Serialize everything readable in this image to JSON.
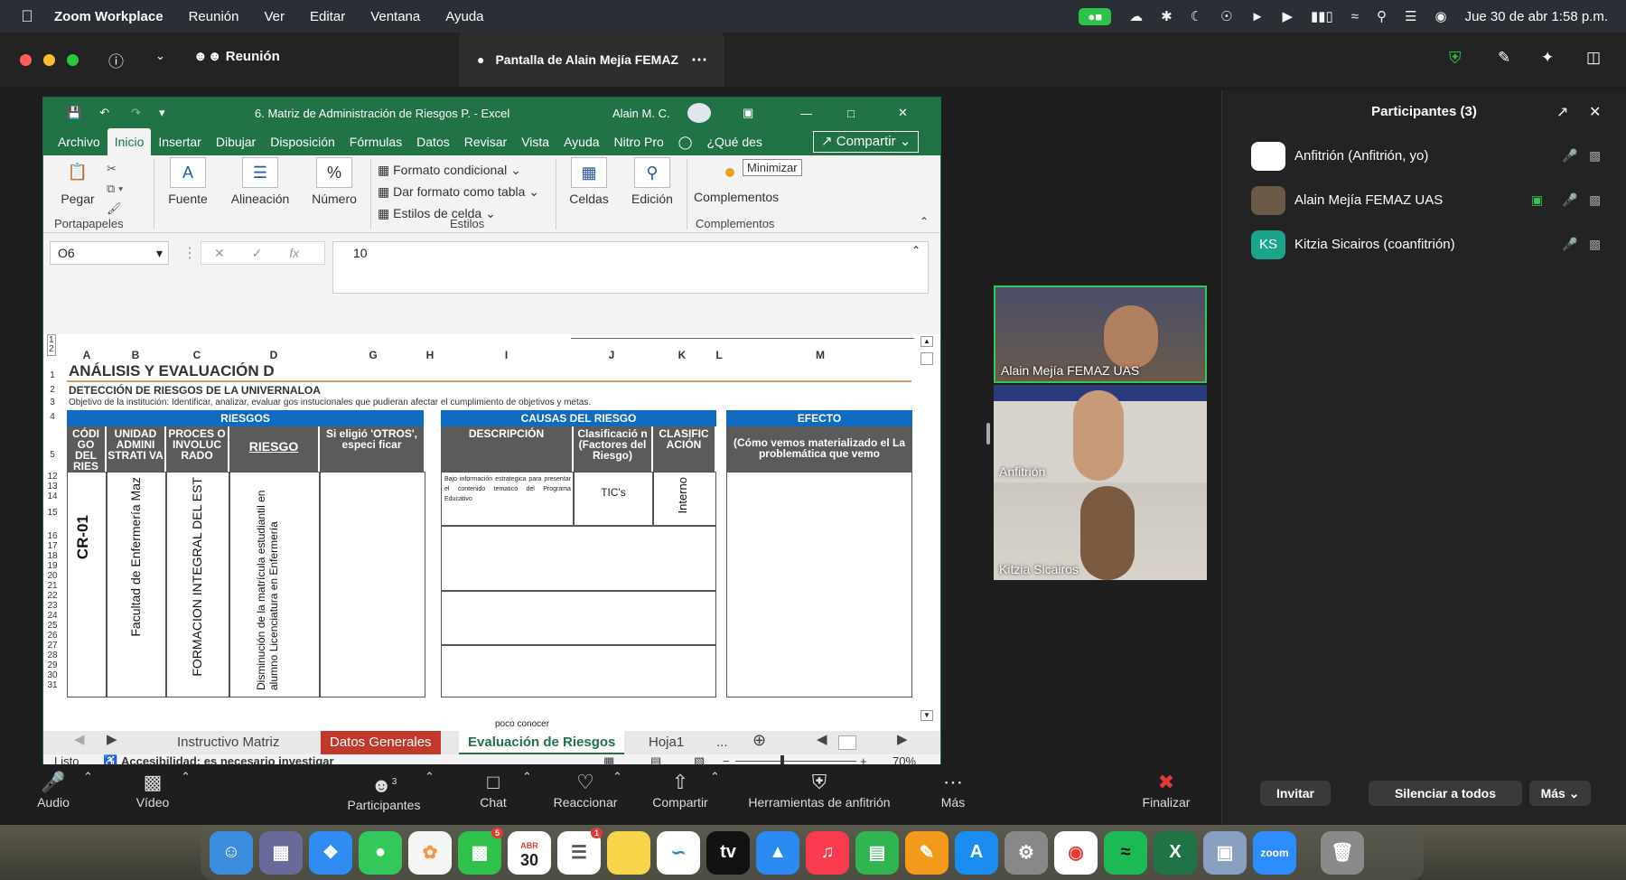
{
  "menubar": {
    "app_name": "Zoom Workplace",
    "items": [
      "Reunión",
      "Ver",
      "Editar",
      "Ventana",
      "Ayuda"
    ],
    "datetime": "Jue 30 de abr  1:58 p.m."
  },
  "zoom": {
    "meeting_label": "Reunión",
    "share_tab_label": "Pantalla de Alain Mejía FEMAZ",
    "panel": {
      "title": "Participantes (3)",
      "participants": [
        {
          "name": "Anfitrión (Anfitrión, yo)",
          "initials": ""
        },
        {
          "name": "Alain Mejía FEMAZ UAS",
          "initials": ""
        },
        {
          "name": "Kitzia Sicairos (coanfitrión)",
          "initials": "KS"
        }
      ],
      "invite_label": "Invitar",
      "mute_all_label": "Silenciar a todos",
      "more_label": "Más"
    },
    "videos": [
      {
        "name": "Alain Mejía FEMAZ UAS"
      },
      {
        "name": "Anfitrión"
      },
      {
        "name": "Kitzia Sicairos"
      }
    ],
    "toolbar": {
      "audio": "Audio",
      "video": "Vídeo",
      "participants": "Participantes",
      "participants_count": "3",
      "chat": "Chat",
      "react": "Reaccionar",
      "share": "Compartir",
      "host_tools": "Herramientas de anfitrión",
      "more": "Más",
      "end": "Finalizar"
    }
  },
  "excel": {
    "title": "6. Matriz de Administración de Riesgos P.  -  Excel",
    "user": "Alain M. C.",
    "tabs": [
      "Archivo",
      "Inicio",
      "Insertar",
      "Dibujar",
      "Disposición",
      "Fórmulas",
      "Datos",
      "Revisar",
      "Vista",
      "Ayuda",
      "Nitro Pro",
      "¿Qué des"
    ],
    "active_tab": "Inicio",
    "share_label": "Compartir",
    "tooltip": "Minimizar",
    "ribbon": {
      "paste": "Pegar",
      "clipboard": "Portapapeles",
      "font": "Fuente",
      "alignment": "Alineación",
      "number": "Número",
      "cond_format": "Formato condicional",
      "table_format": "Dar formato como tabla",
      "cell_styles": "Estilos de celda",
      "styles": "Estilos",
      "cells": "Celdas",
      "editing": "Edición",
      "addins": "Complementos",
      "addins_group": "Complementos"
    },
    "name_box": "O6",
    "formula_value": "10",
    "columns": [
      "A",
      "B",
      "C",
      "D",
      "G",
      "H",
      "I",
      "J",
      "K",
      "L",
      "M"
    ],
    "rows": [
      "1",
      "2",
      "3",
      "4",
      "5",
      "12",
      "13",
      "14",
      "15",
      "16",
      "17",
      "18",
      "19",
      "20",
      "21",
      "22",
      "23",
      "24",
      "25",
      "26",
      "27",
      "28",
      "29",
      "30",
      "31"
    ],
    "sheet": {
      "title": "ANÁLISIS Y EVALUACIÓN D",
      "subtitle": "DETECCIÓN DE RIESGOS DE LA UNIVERNALOA",
      "objective": "Objetivo de la institución: Identificar, analizar, evaluar gos instucionales que pudieran afectar el cumplimiento de objetivos y metas.",
      "band_riesgos": "RIESGOS",
      "band_causas": "CAUSAS DEL RIESGO",
      "band_efecto": "EFECTO",
      "h_codigo": "CÓDI GO DEL RIES",
      "h_unidad": "UNIDAD ADMINI STRATI VA",
      "h_proceso": "PROCES O INVOLUC RADO",
      "h_riesgo": "RIESGO",
      "h_otros": "Si eligió 'OTROS', especi ficar",
      "h_descripcion": "DESCRIPCIÓN",
      "h_clasif1": "Clasificació n (Factores del Riesgo)",
      "h_clasif2": "CLASIFIC ACIÓN",
      "h_efecto": "(Cómo vemos materializado el La problemática que vemo",
      "code": "CR-01",
      "unit": "Facultad de Enfermería Maz",
      "process": "FORMACION INTEGRAL DEL EST",
      "risk": "Disminución de la matrícula estudiantil en alumno Licenciatura en Enfermería",
      "desc": "Bajo información estrategica para presentar el contenido tematico del Programa Educativo",
      "clasif": "TIC's",
      "clasif2": "Interno",
      "partial_bottom": "poco conocer"
    },
    "sheet_tabs": [
      "Instructivo Matriz",
      "Datos Generales",
      "Evaluación de Riesgos",
      "Hoja1",
      "..."
    ],
    "active_sheet": "Evaluación de Riesgos",
    "status_ready": "Listo",
    "accessibility": "Accesibilidad: es necesario investigar",
    "zoom_level": "70%"
  },
  "dock": {
    "calendar_month": "ABR",
    "calendar_day": "30",
    "zoom_label": "zoom",
    "facetime_badge": "5",
    "reminders_badge": "1"
  },
  "colors": {
    "excel_green": "#217346",
    "header_blue": "#0f6bbf",
    "zoom_green": "#2ec24a",
    "end_red": "#e53935"
  }
}
